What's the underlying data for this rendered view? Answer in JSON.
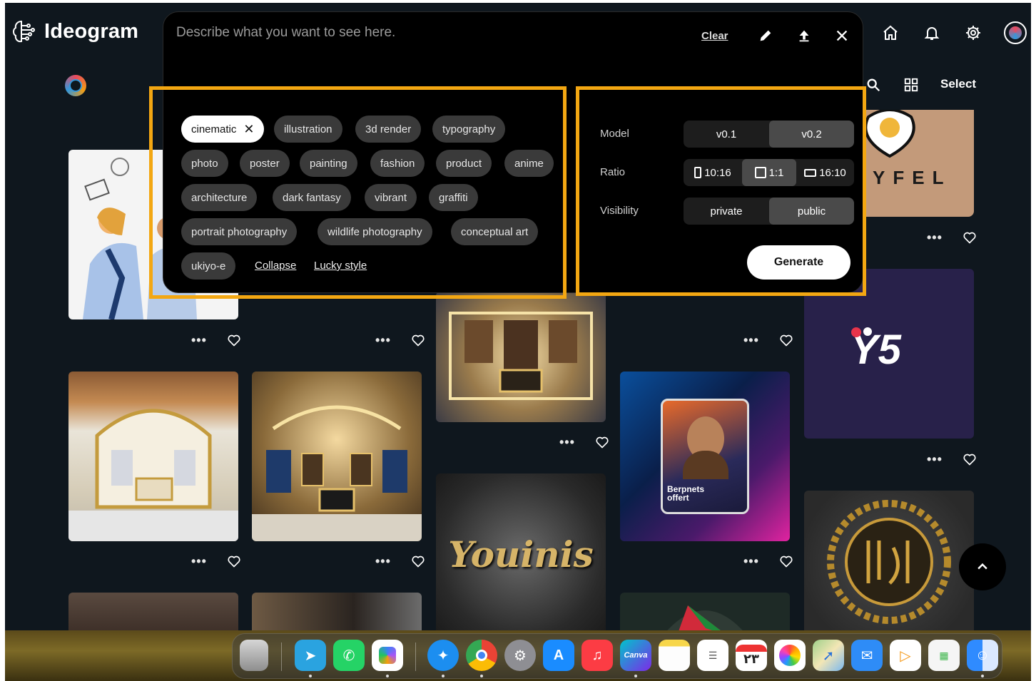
{
  "app": {
    "name": "Ideogram"
  },
  "header": {
    "icons": [
      "home-icon",
      "bell-icon",
      "gear-icon",
      "profile-icon"
    ],
    "select_label": "Select"
  },
  "prompt": {
    "placeholder": "Describe what you want to see here.",
    "clear_label": "Clear",
    "tools": [
      "pencil-icon",
      "upload-icon",
      "close-icon"
    ]
  },
  "styles": {
    "tags": [
      {
        "label": "cinematic",
        "selected": true
      },
      {
        "label": "illustration",
        "selected": false
      },
      {
        "label": "3d render",
        "selected": false
      },
      {
        "label": "typography",
        "selected": false
      },
      {
        "label": "photo",
        "selected": false
      },
      {
        "label": "poster",
        "selected": false
      },
      {
        "label": "painting",
        "selected": false
      },
      {
        "label": "fashion",
        "selected": false
      },
      {
        "label": "product",
        "selected": false
      },
      {
        "label": "anime",
        "selected": false
      },
      {
        "label": "architecture",
        "selected": false
      },
      {
        "label": "dark fantasy",
        "selected": false
      },
      {
        "label": "vibrant",
        "selected": false
      },
      {
        "label": "graffiti",
        "selected": false
      },
      {
        "label": "portrait photography",
        "selected": false
      },
      {
        "label": "wildlife photography",
        "selected": false
      },
      {
        "label": "conceptual art",
        "selected": false
      },
      {
        "label": "ukiyo-e",
        "selected": false
      }
    ],
    "collapse_label": "Collapse",
    "lucky_label": "Lucky style"
  },
  "settings": {
    "model": {
      "label": "Model",
      "options": [
        "v0.1",
        "v0.2"
      ],
      "selected": "v0.2"
    },
    "ratio": {
      "label": "Ratio",
      "options": [
        "10:16",
        "1:1",
        "16:10"
      ],
      "selected": "1:1"
    },
    "visibility": {
      "label": "Visibility",
      "options": [
        "private",
        "public"
      ],
      "selected": "public"
    },
    "generate_label": "Generate"
  },
  "gallery": {
    "visible_text": [
      "YFEL",
      "Youinis",
      "Berpnets offert"
    ]
  },
  "dock": {
    "apps": [
      "Trash",
      "Telegram",
      "WhatsApp",
      "Copilot",
      "Safari",
      "Chrome",
      "System Settings",
      "App Store",
      "Music",
      "Canva",
      "Notes",
      "Reminders",
      "Calendar",
      "Photos",
      "Maps",
      "Mail",
      "Infuse",
      "Numbers",
      "Finder"
    ],
    "calendar_date": "۲۳"
  },
  "colors": {
    "highlight": "#f3a712",
    "background": "#0f171e",
    "panel": "#000000"
  }
}
